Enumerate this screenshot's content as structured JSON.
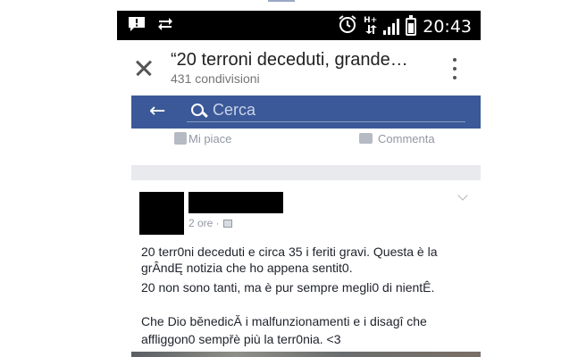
{
  "status_bar": {
    "time": "20:43",
    "network_label_top": "H+",
    "icons": [
      "notification-icon",
      "sync-icon",
      "alarm-icon",
      "h-plus-data-icon",
      "signal-icon",
      "battery-icon"
    ]
  },
  "app_bar": {
    "title": "“20 terroni deceduti, grande…",
    "subtitle": "431 condivisioni"
  },
  "facebook": {
    "search_placeholder": "Cerca",
    "like_label": "Mi piace",
    "comment_label": "Commenta",
    "post_meta": "2 ore ·",
    "post_lines": [
      "20 terr0ni deceduti e circa 35 i feriti gravi. Questa è la",
      "grÂndĘ notizia che ho appena sentit0.",
      "20 non sono tanti, ma è pur sempre megli0 di nientÊ.",
      "",
      "Che Dio bĕnedicĂ i malfunzionamenti e i disagî che",
      "affliggon0 sempřè più la terr0nia. <3"
    ]
  },
  "colors": {
    "facebook_blue": "#3b5998",
    "status_bar_bg": "#000000",
    "divider": "#e9eaed"
  }
}
